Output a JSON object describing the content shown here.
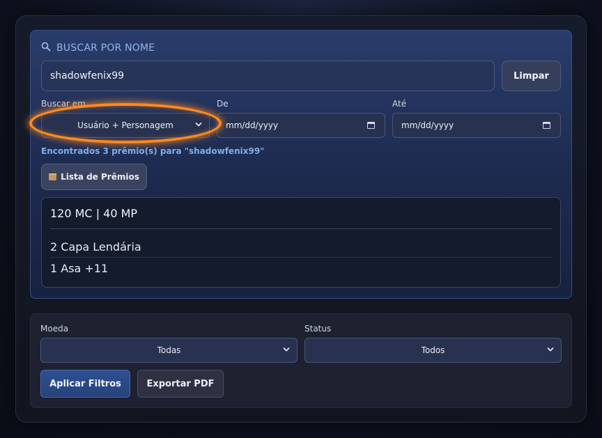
{
  "search": {
    "title": "BUSCAR POR NOME",
    "title_icon": "search-icon",
    "input_value": "shadowfenix99",
    "clear_label": "Limpar",
    "search_in_label": "Buscar em",
    "search_in_selected": "Usuário + Personagem",
    "from_label": "De",
    "from_placeholder": "mm/dd/yyyy",
    "to_label": "Até",
    "to_placeholder": "mm/dd/yyyy",
    "found_text": "Encontrados 3 prêmio(s) para \"shadowfenix99\"",
    "list_button_label": "Lista de Prêmios",
    "list_button_icon": "package-icon"
  },
  "prizes": {
    "header": "120 MC | 40 MP",
    "items": [
      "2 Capa Lendária",
      "1 Asa +11"
    ]
  },
  "filters": {
    "currency_label": "Moeda",
    "currency_selected": "Todas",
    "status_label": "Status",
    "status_selected": "Todos",
    "apply_label": "Aplicar Filtros",
    "export_label": "Exportar PDF"
  },
  "colors": {
    "highlight_ring": "#ff8a1e",
    "accent": "#2f4f91",
    "link_text": "#7fb0ea"
  }
}
